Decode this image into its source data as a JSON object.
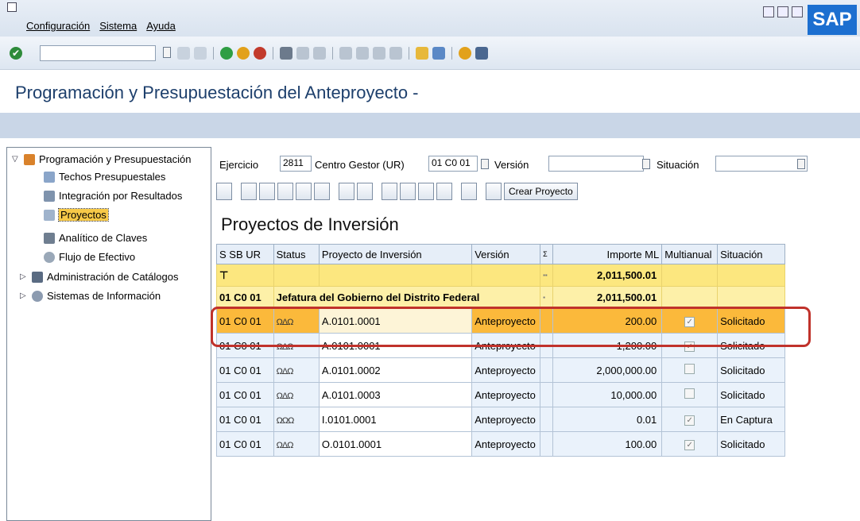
{
  "menu": [
    "Configuración",
    "Sistema",
    "Ayuda"
  ],
  "brand": "SAP",
  "page_title": "Programación y Presupuestación del Anteproyecto -",
  "tree": [
    {
      "label": "Programación y Presupuestación",
      "level": 0
    },
    {
      "label": "Techos Presupuestales",
      "level": 1
    },
    {
      "label": "Integración por Resultados",
      "level": 1
    },
    {
      "label": "Proyectos",
      "level": 1,
      "selected": true
    },
    {
      "label": "Analítico de Claves",
      "level": 1
    },
    {
      "label": "Flujo de Efectivo",
      "level": 1
    },
    {
      "label": "Administración de Catálogos",
      "level": 0
    },
    {
      "label": "Sistemas de Información",
      "level": 0
    }
  ],
  "selection": {
    "ejercicio_label": "Ejercicio",
    "ejercicio_value": "2811",
    "centro_label": "Centro Gestor (UR)",
    "centro_value": "01 C0 01",
    "version_label": "Versión",
    "version_value": "",
    "situacion_label": "Situación",
    "situacion_value": ""
  },
  "crear_proyecto": "Crear Proyecto",
  "grid_title": "Proyectos de Inversión",
  "columns": [
    "S SB UR",
    "Status",
    "Proyecto de Inversión",
    "Versión",
    "Σ",
    "Importe ML",
    "Multianual",
    "Situación"
  ],
  "total": {
    "importe": "2,011,500.01"
  },
  "subtotal": {
    "ur": "01 C0 01",
    "name": "Jefatura del Gobierno del Distrito Federal",
    "importe": "2,011,500.01"
  },
  "rows": [
    {
      "ur": "01 C0 01",
      "status": "ΩΔΩ",
      "proyecto": "A.0101.0001",
      "version": "Anteproyecto",
      "importe": "200.00",
      "multianual": true,
      "situacion": "Solicitado"
    },
    {
      "ur": "01 C0 01",
      "status": "ΩΔΩ",
      "proyecto": "A.0101.0001",
      "version": "Anteproyecto",
      "importe": "1,200.00",
      "multianual": true,
      "situacion": "Solicitado"
    },
    {
      "ur": "01 C0 01",
      "status": "ΩΔΩ",
      "proyecto": "A.0101.0002",
      "version": "Anteproyecto",
      "importe": "2,000,000.00",
      "multianual": false,
      "situacion": "Solicitado"
    },
    {
      "ur": "01 C0 01",
      "status": "ΩΔΩ",
      "proyecto": "A.0101.0003",
      "version": "Anteproyecto",
      "importe": "10,000.00",
      "multianual": false,
      "situacion": "Solicitado"
    },
    {
      "ur": "01 C0 01",
      "status": "ΩΩΩ",
      "proyecto": "I.0101.0001",
      "version": "Anteproyecto",
      "importe": "0.01",
      "multianual": true,
      "situacion": "En Captura"
    },
    {
      "ur": "01 C0 01",
      "status": "ΩΔΩ",
      "proyecto": "O.0101.0001",
      "version": "Anteproyecto",
      "importe": "100.00",
      "multianual": true,
      "situacion": "Solicitado"
    }
  ]
}
